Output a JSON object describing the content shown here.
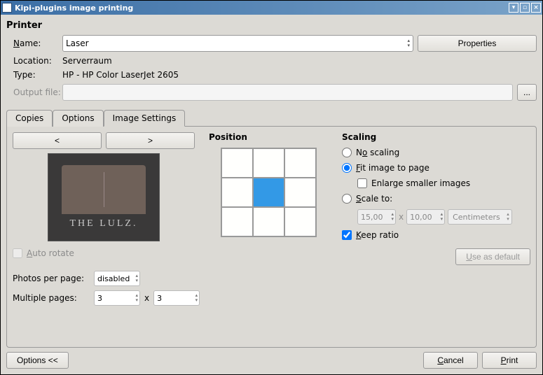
{
  "window": {
    "title": "Kipi-plugins image printing"
  },
  "printer": {
    "group_title": "Printer",
    "name_label": "Name:",
    "name_value": "Laser",
    "properties_label": "Properties",
    "location_label": "Location:",
    "location_value": "Serverraum",
    "type_label": "Type:",
    "type_value": "HP - HP Color LaserJet 2605",
    "output_label": "Output file:",
    "output_value": "",
    "browse_label": "..."
  },
  "tabs": {
    "copies": "Copies",
    "options": "Options",
    "image_settings": "Image Settings"
  },
  "image_settings": {
    "prev_label": "<",
    "next_label": ">",
    "preview_big": "THE LULZ.",
    "preview_small": "",
    "auto_rotate_label": "Auto rotate",
    "auto_rotate_checked": false,
    "auto_rotate_enabled": false,
    "position_label": "Position",
    "position_selected": 4,
    "scaling": {
      "heading": "Scaling",
      "no_scaling": "No scaling",
      "fit_page": "Fit image to page",
      "enlarge": "Enlarge smaller images",
      "enlarge_checked": false,
      "scale_to": "Scale to:",
      "width": "15,00",
      "height": "10,00",
      "times": "x",
      "unit": "Centimeters",
      "keep_ratio": "Keep ratio",
      "keep_ratio_checked": true,
      "selected": "fit"
    },
    "use_default": "Use as default",
    "photos_per_page_label": "Photos per page:",
    "photos_per_page_value": "disabled",
    "multiple_pages_label": "Multiple pages:",
    "multiple_cols": "3",
    "multiple_times": "x",
    "multiple_rows": "3"
  },
  "footer": {
    "options": "Options <<",
    "cancel": "Cancel",
    "print": "Print"
  }
}
